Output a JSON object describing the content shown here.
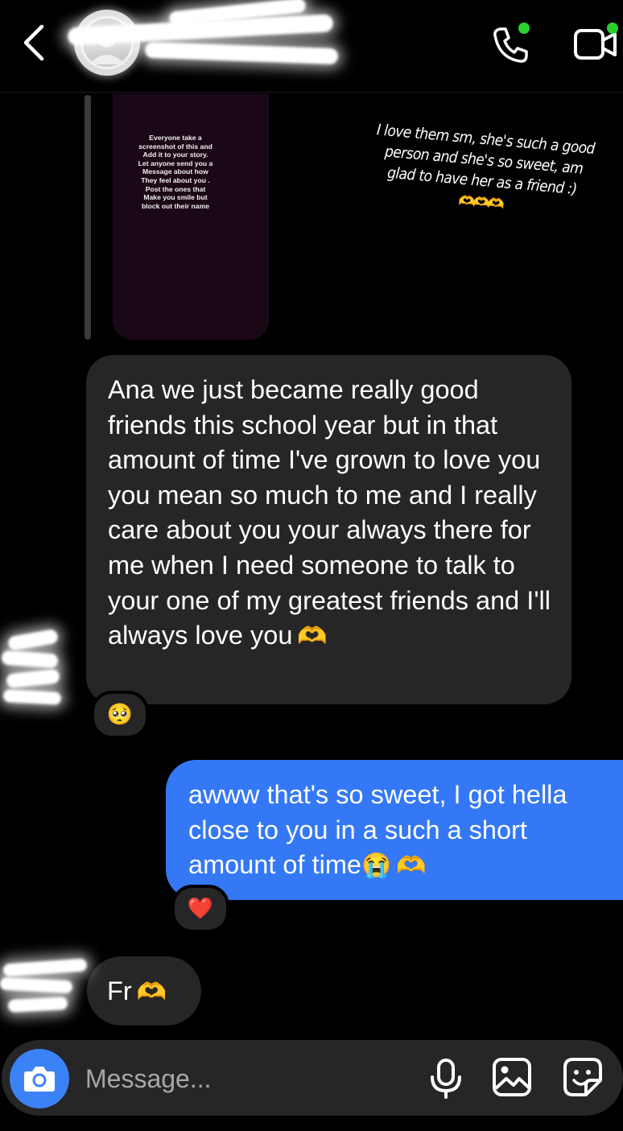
{
  "header": {
    "back_icon": "chevron-left-icon",
    "call_icon": "phone-icon",
    "video_icon": "video-camera-icon",
    "active_color": "#2bd12b"
  },
  "story_reply": {
    "story_text": "Everyone take a\nscreenshot of this and\nAdd it to your story.\nLet anyone send you a\nMessage about how\nThey feel about you .\nPost the ones that\nMake you smile but\nblock out their name",
    "caption": "I love them sm, she's such a good person and she's so sweet, am glad to have her as a friend :)",
    "caption_emoji": "🫶🫶🫶"
  },
  "messages": [
    {
      "direction": "incoming",
      "text": "Ana we just became really good friends this school year but in that amount of time I've grown to love you you mean so much to me and I really care about you your always there for me when I need someone to talk to your one of my greatest friends and I'll always love you",
      "emoji": "🫶",
      "reaction": "🥺"
    },
    {
      "direction": "outgoing",
      "text": "awww that's so sweet, I got hella close to you in a such a short amount of time",
      "emoji_cry": "😭",
      "emoji": "🫶",
      "reaction": "❤️"
    },
    {
      "direction": "incoming",
      "text": "Fr",
      "emoji": "🫶"
    }
  ],
  "composer": {
    "placeholder": "Message...",
    "camera_icon": "camera-icon",
    "mic_icon": "microphone-icon",
    "gallery_icon": "image-icon",
    "sticker_icon": "sticker-icon",
    "camera_color": "#3b82f6",
    "outgoing_color": "#3478f6"
  }
}
